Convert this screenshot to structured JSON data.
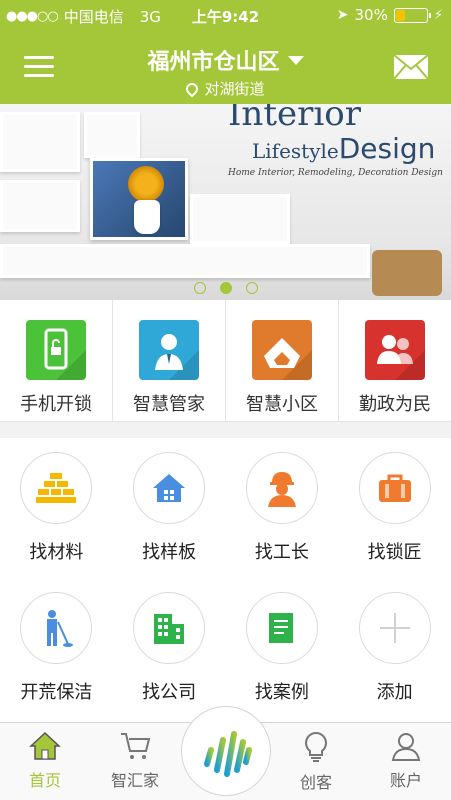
{
  "status_bar": {
    "carrier": "中国电信",
    "network": "3G",
    "time": "上午9:42",
    "battery": "30%",
    "battery_level": 0.3
  },
  "header": {
    "city": "福州市仓山区",
    "street": "对湖街道"
  },
  "banner": {
    "title": "Interior",
    "subtitle_script": "Lifestyle",
    "subtitle_main": "Design",
    "tagline": "Home Interior, Remodeling, Decoration Design",
    "active_slide": 2,
    "slide_count": 3
  },
  "quick_actions": [
    {
      "label": "手机开锁",
      "color": "#4cc23a",
      "icon": "phone-lock-icon"
    },
    {
      "label": "智慧管家",
      "color": "#2fa8d8",
      "icon": "butler-icon"
    },
    {
      "label": "智慧小区",
      "color": "#e07a2c",
      "icon": "community-icon"
    },
    {
      "label": "勤政为民",
      "color": "#d8322f",
      "icon": "government-icon"
    }
  ],
  "services": [
    {
      "label": "找材料",
      "icon": "bricks-icon",
      "color": "#f5b800"
    },
    {
      "label": "找样板",
      "icon": "house-icon",
      "color": "#4a8ee0"
    },
    {
      "label": "找工长",
      "icon": "worker-icon",
      "color": "#f07b2e"
    },
    {
      "label": "找锁匠",
      "icon": "toolbox-icon",
      "color": "#f07b2e"
    },
    {
      "label": "开荒保洁",
      "icon": "cleaner-icon",
      "color": "#4a8ee0"
    },
    {
      "label": "找公司",
      "icon": "building-icon",
      "color": "#2db34a"
    },
    {
      "label": "找案例",
      "icon": "case-doc-icon",
      "color": "#2db34a"
    },
    {
      "label": "添加",
      "icon": "plus-icon",
      "color": "#d0d0d0"
    }
  ],
  "tabs": [
    {
      "label": "首页",
      "icon": "home-icon",
      "active": true
    },
    {
      "label": "智汇家",
      "icon": "cart-icon",
      "active": false
    },
    {
      "label": "创客",
      "icon": "lightbulb-icon",
      "active": false
    },
    {
      "label": "账户",
      "icon": "user-icon",
      "active": false
    }
  ],
  "colors": {
    "accent": "#a4c639"
  }
}
